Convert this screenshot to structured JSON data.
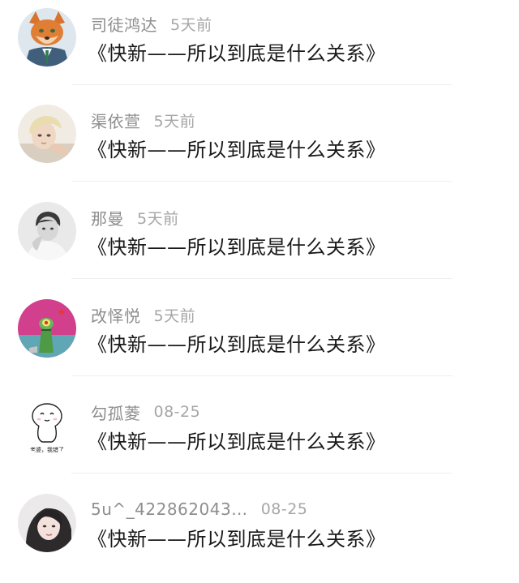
{
  "comments": [
    {
      "name": "司徒鸿达",
      "time": "5天前",
      "text": "《快新——所以到底是什么关系》",
      "avatar": "fox-character-avatar"
    },
    {
      "name": "渠依萱",
      "time": "5天前",
      "text": "《快新——所以到底是什么关系》",
      "avatar": "blond-person-avatar"
    },
    {
      "name": "那曼",
      "time": "5天前",
      "text": "《快新——所以到底是什么关系》",
      "avatar": "grayscale-person-avatar"
    },
    {
      "name": "改怿悦",
      "time": "5天前",
      "text": "《快新——所以到底是什么关系》",
      "avatar": "plankton-cartoon-avatar"
    },
    {
      "name": "勾孤菱",
      "time": "08-25",
      "text": "《快新——所以到底是什么关系》",
      "avatar": "white-blob-sticker-avatar",
      "avatar_caption": "老婆，我错了"
    },
    {
      "name": "5u^_422862043…",
      "time": "08-25",
      "text": "《快新——所以到底是什么关系》",
      "avatar": "woman-photo-avatar"
    }
  ]
}
